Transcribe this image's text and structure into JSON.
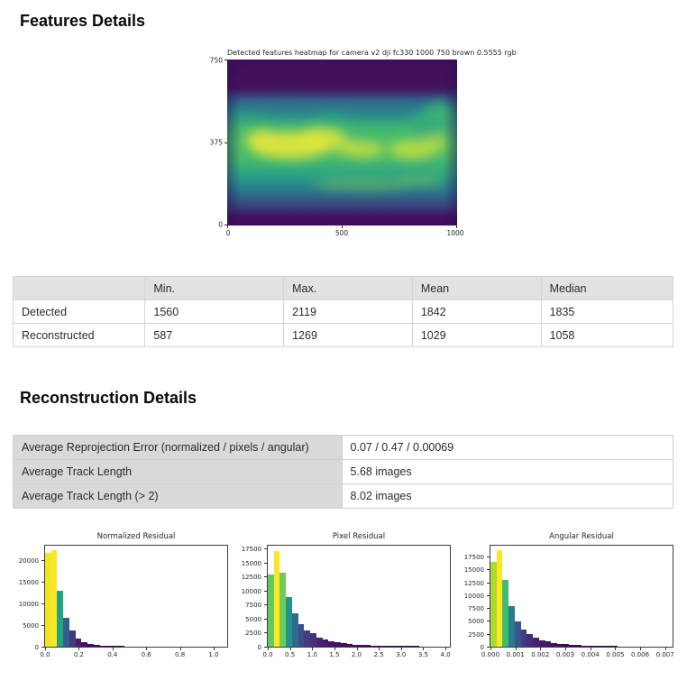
{
  "page": {
    "features_heading": "Features Details",
    "reconstruction_heading": "Reconstruction Details"
  },
  "features_table": {
    "headers": [
      "",
      "Min.",
      "Max.",
      "Mean",
      "Median"
    ],
    "rows": [
      [
        "Detected",
        "1560",
        "2119",
        "1842",
        "1835"
      ],
      [
        "Reconstructed",
        "587",
        "1269",
        "1029",
        "1058"
      ]
    ]
  },
  "reconstruction_table": {
    "rows": [
      {
        "label": "Average Reprojection Error (normalized / pixels / angular)",
        "value": "0.07 / 0.47 / 0.00069"
      },
      {
        "label": "Average Track Length",
        "value": "5.68 images"
      },
      {
        "label": "Average Track Length (> 2)",
        "value": "8.02 images"
      }
    ]
  },
  "chart_data": [
    {
      "type": "heatmap",
      "title": "Detected features heatmap for camera v2 dji fc330 1000 750 brown 0.5555 rgb",
      "xlabel": "",
      "ylabel": "",
      "x_range": [
        0,
        1000
      ],
      "y_range": [
        0,
        750
      ],
      "x_ticks": [
        0,
        500,
        1000
      ],
      "x_tick_labels": [
        "0",
        "500",
        "1000"
      ],
      "y_ticks": [
        750,
        375,
        0
      ],
      "y_tick_labels": [
        "750",
        "375",
        "0"
      ],
      "colormap": "viridis",
      "description": "Low density (dark purple) along top and bottom edges; high density green band across the middle with brightest yellow patches left of center around y 280-450; green bump rising at the right edge near x 900."
    },
    {
      "type": "bar",
      "title": "Normalized Residual",
      "bin_start": 0,
      "bin_width": 0.036,
      "values": [
        21800,
        22300,
        13000,
        6600,
        3700,
        1850,
        1050,
        650,
        420,
        300,
        220,
        160,
        120,
        95,
        75,
        60,
        48,
        38,
        30,
        25,
        20,
        17,
        14,
        12,
        10,
        8,
        7,
        6,
        5,
        4
      ],
      "xlim": [
        0,
        1.08
      ],
      "ylim": [
        0,
        23400
      ],
      "x_ticks": [
        {
          "v": 0.0,
          "label": "0.0"
        },
        {
          "v": 0.2,
          "label": "0.2"
        },
        {
          "v": 0.4,
          "label": "0.4"
        },
        {
          "v": 0.6,
          "label": "0.6"
        },
        {
          "v": 0.8,
          "label": "0.8"
        },
        {
          "v": 1.0,
          "label": "1.0"
        }
      ],
      "y_ticks": [
        {
          "v": 0,
          "label": "0"
        },
        {
          "v": 5000,
          "label": "5000"
        },
        {
          "v": 10000,
          "label": "10000"
        },
        {
          "v": 15000,
          "label": "15000"
        },
        {
          "v": 20000,
          "label": "20000"
        }
      ],
      "colormap": "viridis mapped to bar height"
    },
    {
      "type": "bar",
      "title": "Pixel Residual",
      "bin_start": 0,
      "bin_width": 0.1367,
      "values": [
        12800,
        17000,
        13200,
        8800,
        5900,
        4050,
        2950,
        2400,
        1650,
        1250,
        950,
        740,
        580,
        460,
        370,
        300,
        250,
        210,
        180,
        155,
        135,
        120,
        105,
        95,
        85,
        78,
        70,
        64,
        58,
        52
      ],
      "xlim": [
        0,
        4.1
      ],
      "ylim": [
        0,
        18000
      ],
      "x_ticks": [
        {
          "v": 0.0,
          "label": "0.0"
        },
        {
          "v": 0.5,
          "label": "0.5"
        },
        {
          "v": 1.0,
          "label": "1.0"
        },
        {
          "v": 1.5,
          "label": "1.5"
        },
        {
          "v": 2.0,
          "label": "2.0"
        },
        {
          "v": 2.5,
          "label": "2.5"
        },
        {
          "v": 3.0,
          "label": "3.0"
        },
        {
          "v": 3.5,
          "label": "3.5"
        },
        {
          "v": 4.0,
          "label": "4.0"
        }
      ],
      "y_ticks": [
        {
          "v": 0,
          "label": "0"
        },
        {
          "v": 2500,
          "label": "2500"
        },
        {
          "v": 5000,
          "label": "5000"
        },
        {
          "v": 7500,
          "label": "7500"
        },
        {
          "v": 10000,
          "label": "10000"
        },
        {
          "v": 12500,
          "label": "12500"
        },
        {
          "v": 15000,
          "label": "15000"
        },
        {
          "v": 17500,
          "label": "17500"
        }
      ],
      "colormap": "viridis mapped to bar height"
    },
    {
      "type": "bar",
      "title": "Angular Residual",
      "bin_start": 0,
      "bin_width": 0.000243,
      "values": [
        16400,
        18800,
        12950,
        7850,
        4950,
        3300,
        2400,
        1750,
        1300,
        980,
        750,
        580,
        450,
        360,
        290,
        235,
        195,
        160,
        135,
        115,
        98,
        85,
        74,
        65,
        57,
        50,
        45,
        40,
        36,
        32
      ],
      "xlim": [
        0,
        0.0073
      ],
      "ylim": [
        0,
        19600
      ],
      "x_ticks": [
        {
          "v": 0.0,
          "label": "0.000"
        },
        {
          "v": 0.001,
          "label": "0.001"
        },
        {
          "v": 0.002,
          "label": "0.002"
        },
        {
          "v": 0.003,
          "label": "0.003"
        },
        {
          "v": 0.004,
          "label": "0.004"
        },
        {
          "v": 0.005,
          "label": "0.005"
        },
        {
          "v": 0.006,
          "label": "0.006"
        },
        {
          "v": 0.007,
          "label": "0.007"
        }
      ],
      "y_ticks": [
        {
          "v": 0,
          "label": "0"
        },
        {
          "v": 2500,
          "label": "2500"
        },
        {
          "v": 5000,
          "label": "5000"
        },
        {
          "v": 7500,
          "label": "7500"
        },
        {
          "v": 10000,
          "label": "10000"
        },
        {
          "v": 12500,
          "label": "12500"
        },
        {
          "v": 15000,
          "label": "15000"
        },
        {
          "v": 17500,
          "label": "17500"
        }
      ],
      "colormap": "viridis mapped to bar height"
    }
  ],
  "colors": {
    "viridis_low": "#440154",
    "viridis_mid": "#21918c",
    "viridis_high": "#fde725",
    "table_header_bg": "#e2e2e2",
    "table_label_bg": "#d9d9d9",
    "table_border": "#d5d5d5"
  }
}
